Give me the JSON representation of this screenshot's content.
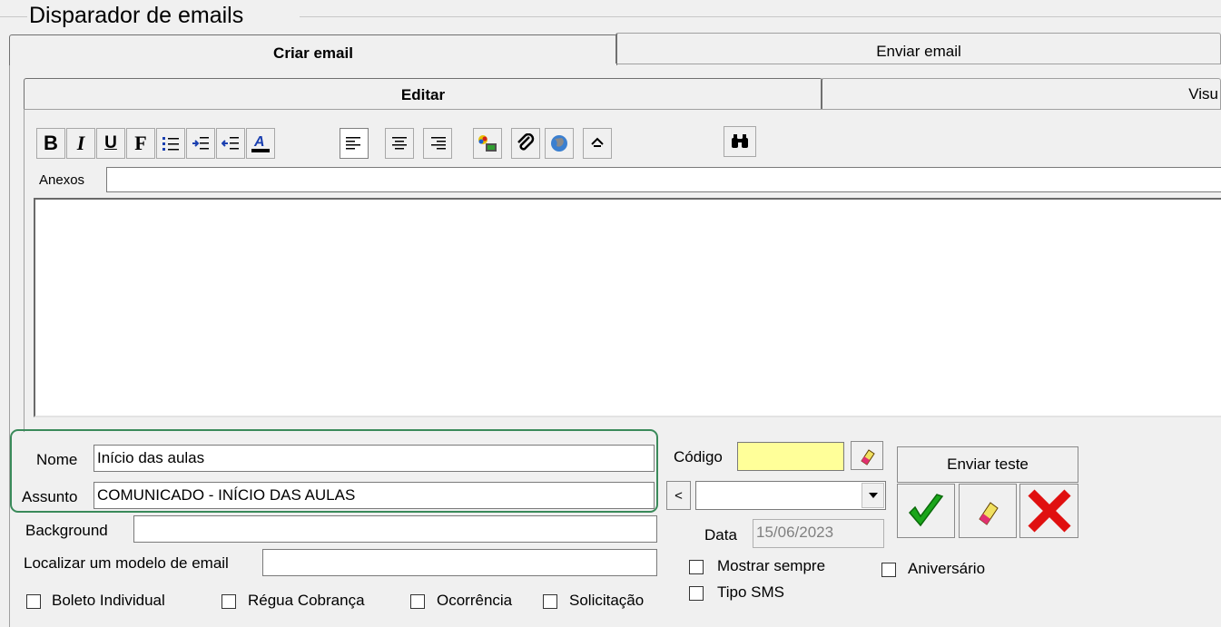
{
  "window": {
    "group_title": "Disparador de emails"
  },
  "tabs": {
    "outer": [
      {
        "label": "Criar email"
      },
      {
        "label": "Enviar email"
      }
    ],
    "inner": [
      {
        "label": "Editar"
      },
      {
        "label": "Visu"
      }
    ]
  },
  "toolbar": {
    "bold": "B",
    "italic": "I",
    "underline": "U",
    "font": "F"
  },
  "attachments": {
    "label": "Anexos",
    "value": ""
  },
  "form": {
    "nome_label": "Nome",
    "nome_value": "Início das aulas",
    "assunto_label": "Assunto",
    "assunto_value": "COMUNICADO - INÍCIO DAS AULAS",
    "background_label": "Background",
    "background_value": "",
    "localizar_label": "Localizar um modelo de email",
    "localizar_value": "",
    "codigo_label": "Código",
    "codigo_value": "",
    "nav_prev": "<",
    "combo_value": "",
    "data_label": "Data",
    "data_value": "15/06/2023",
    "enviar_teste_label": "Enviar teste"
  },
  "checkboxes": {
    "boleto_individual": "Boleto Individual",
    "regua_cobranca": "Régua Cobrança",
    "ocorrencia": "Ocorrência",
    "solicitacao": "Solicitação",
    "mostrar_sempre": "Mostrar sempre",
    "aniversario": "Aniversário",
    "tipo_sms": "Tipo SMS"
  },
  "colors": {
    "highlight_border": "#3a8a5a",
    "codigo_bg": "#ffff99",
    "confirm_green": "#1aa61a",
    "cancel_red": "#e01010"
  }
}
